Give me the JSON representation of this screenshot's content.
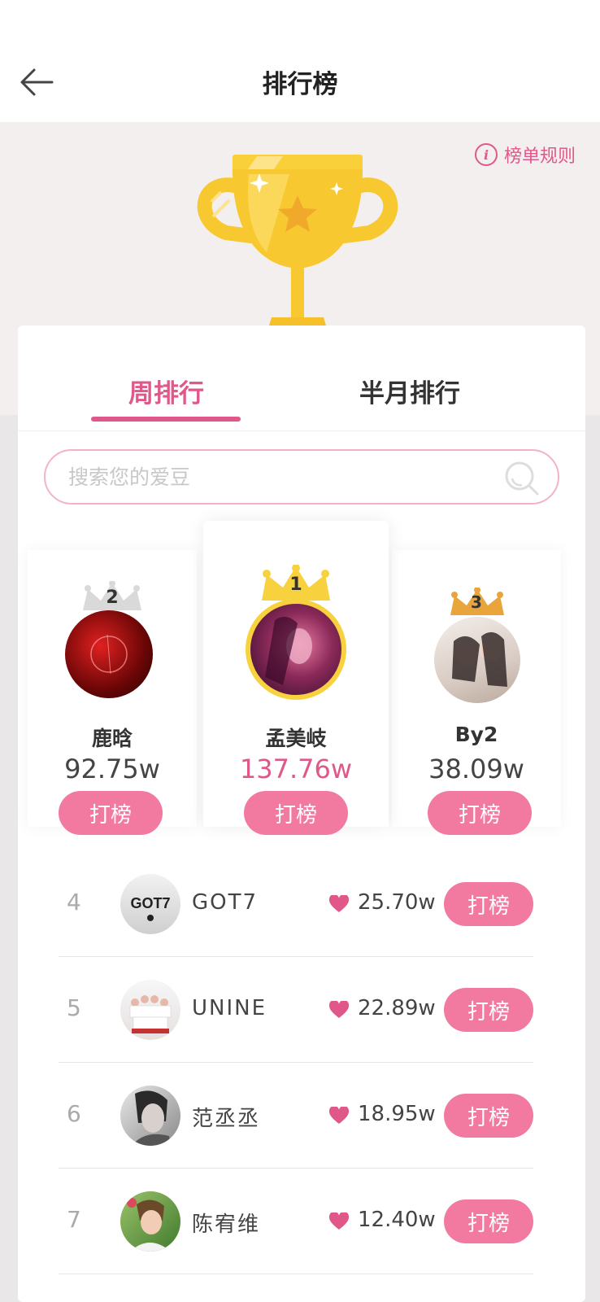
{
  "header": {
    "title": "排行榜",
    "back_icon": "arrow-left-icon"
  },
  "banner": {
    "rules_label": "榜单规则",
    "rules_icon": "info-icon",
    "info_glyph": "i",
    "trophy_icon": "trophy-icon"
  },
  "tabs": [
    {
      "label": "周排行",
      "active": true
    },
    {
      "label": "半月排行",
      "active": false
    }
  ],
  "search": {
    "placeholder": "搜索您的爱豆",
    "icon": "search-icon"
  },
  "podium": [
    {
      "rank": "2",
      "name": "鹿晗",
      "score": "92.75w",
      "button": "打榜",
      "crown": "silver-crown-icon"
    },
    {
      "rank": "1",
      "name": "孟美岐",
      "score": "137.76w",
      "button": "打榜",
      "crown": "gold-crown-icon"
    },
    {
      "rank": "3",
      "name": "By2",
      "score": "38.09w",
      "button": "打榜",
      "crown": "bronze-crown-icon"
    }
  ],
  "list": [
    {
      "rank": "4",
      "name": "GOT7",
      "score": "25.70w",
      "button": "打榜",
      "avatar_logo": "GOT7"
    },
    {
      "rank": "5",
      "name": "UNINE",
      "score": "22.89w",
      "button": "打榜"
    },
    {
      "rank": "6",
      "name": "范丞丞",
      "score": "18.95w",
      "button": "打榜"
    },
    {
      "rank": "7",
      "name": "陈宥维",
      "score": "12.40w",
      "button": "打榜"
    }
  ],
  "colors": {
    "accent": "#e0588a",
    "button": "#f27aa1",
    "gold": "#f7c830"
  }
}
